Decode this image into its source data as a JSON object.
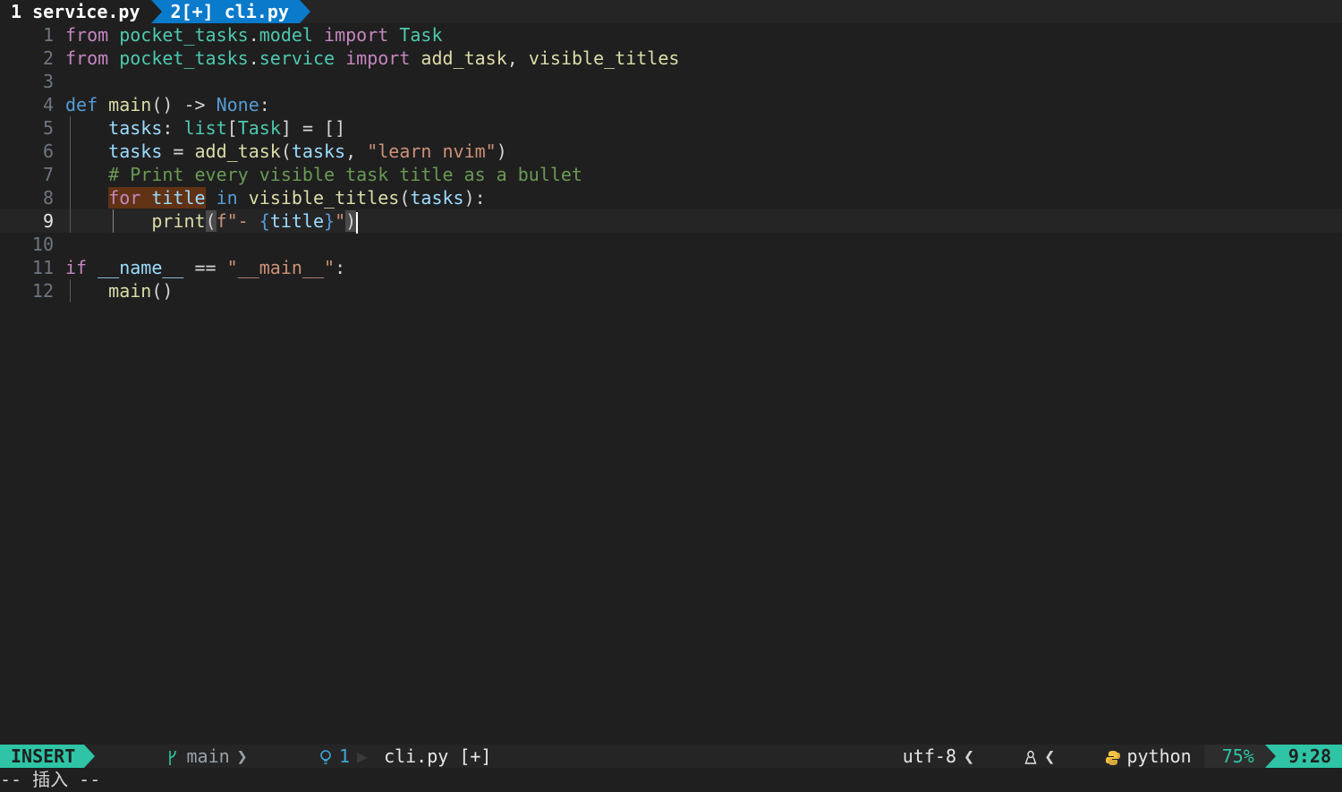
{
  "tabs": [
    {
      "label": "1 service.py",
      "active": false
    },
    {
      "label": "2[+] cli.py",
      "active": true
    }
  ],
  "editor": {
    "line_numbers": [
      "1",
      "2",
      "3",
      "4",
      "5",
      "6",
      "7",
      "8",
      "9",
      "10",
      "11",
      "12"
    ],
    "current_line": "9",
    "lines": [
      [
        {
          "t": "from",
          "c": "kw"
        },
        {
          "t": " ",
          "c": "op"
        },
        {
          "t": "pocket_tasks",
          "c": "cls"
        },
        {
          "t": ".",
          "c": "op"
        },
        {
          "t": "model",
          "c": "cls"
        },
        {
          "t": " ",
          "c": "op"
        },
        {
          "t": "import",
          "c": "kw"
        },
        {
          "t": " ",
          "c": "op"
        },
        {
          "t": "Task",
          "c": "cls"
        }
      ],
      [
        {
          "t": "from",
          "c": "kw"
        },
        {
          "t": " ",
          "c": "op"
        },
        {
          "t": "pocket_tasks",
          "c": "cls"
        },
        {
          "t": ".",
          "c": "op"
        },
        {
          "t": "service",
          "c": "cls"
        },
        {
          "t": " ",
          "c": "op"
        },
        {
          "t": "import",
          "c": "kw"
        },
        {
          "t": " ",
          "c": "op"
        },
        {
          "t": "add_task",
          "c": "fn"
        },
        {
          "t": ", ",
          "c": "op"
        },
        {
          "t": "visible_titles",
          "c": "fn"
        }
      ],
      [],
      [
        {
          "t": "def",
          "c": "kwb"
        },
        {
          "t": " ",
          "c": "op"
        },
        {
          "t": "main",
          "c": "fn"
        },
        {
          "t": "() -> ",
          "c": "op"
        },
        {
          "t": "None",
          "c": "kwb"
        },
        {
          "t": ":",
          "c": "op"
        }
      ],
      [
        {
          "t": "    ",
          "c": "op"
        },
        {
          "t": "tasks",
          "c": "var"
        },
        {
          "t": ": ",
          "c": "op"
        },
        {
          "t": "list",
          "c": "cls"
        },
        {
          "t": "[",
          "c": "op"
        },
        {
          "t": "Task",
          "c": "cls"
        },
        {
          "t": "] = []",
          "c": "op"
        }
      ],
      [
        {
          "t": "    ",
          "c": "op"
        },
        {
          "t": "tasks",
          "c": "var"
        },
        {
          "t": " = ",
          "c": "op"
        },
        {
          "t": "add_task",
          "c": "fn"
        },
        {
          "t": "(",
          "c": "op"
        },
        {
          "t": "tasks",
          "c": "var"
        },
        {
          "t": ", ",
          "c": "op"
        },
        {
          "t": "\"learn nvim\"",
          "c": "str"
        },
        {
          "t": ")",
          "c": "op"
        }
      ],
      [
        {
          "t": "    ",
          "c": "op"
        },
        {
          "t": "# Print every visible task title as a bullet",
          "c": "cmt"
        }
      ],
      [
        {
          "t": "    ",
          "c": "op"
        },
        {
          "t": "for",
          "c": "kw mark"
        },
        {
          "t": " ",
          "c": "op mark"
        },
        {
          "t": "title",
          "c": "var mark"
        },
        {
          "t": " ",
          "c": "op"
        },
        {
          "t": "in",
          "c": "kwb"
        },
        {
          "t": " ",
          "c": "op"
        },
        {
          "t": "visible_titles",
          "c": "fn"
        },
        {
          "t": "(",
          "c": "op"
        },
        {
          "t": "tasks",
          "c": "var"
        },
        {
          "t": "):",
          "c": "op"
        }
      ],
      [
        {
          "t": "        ",
          "c": "op"
        },
        {
          "t": "print",
          "c": "fn"
        },
        {
          "t": "(",
          "c": "op bracket"
        },
        {
          "t": "f\"- ",
          "c": "str"
        },
        {
          "t": "{",
          "c": "kwb"
        },
        {
          "t": "title",
          "c": "var"
        },
        {
          "t": "}",
          "c": "kwb"
        },
        {
          "t": "\"",
          "c": "str"
        },
        {
          "t": ")",
          "c": "op bracket"
        }
      ],
      [],
      [
        {
          "t": "if",
          "c": "kw"
        },
        {
          "t": " ",
          "c": "op"
        },
        {
          "t": "__name__",
          "c": "var"
        },
        {
          "t": " == ",
          "c": "op"
        },
        {
          "t": "\"__main__\"",
          "c": "str"
        },
        {
          "t": ":",
          "c": "op"
        }
      ],
      [
        {
          "t": "    ",
          "c": "op"
        },
        {
          "t": "main",
          "c": "fn"
        },
        {
          "t": "()",
          "c": "op"
        }
      ]
    ]
  },
  "statusline": {
    "mode": "INSERT",
    "git_icon": "git-branch-icon",
    "branch": "main",
    "diagnostic_icon": "lightbulb-icon",
    "diagnostic_count": "1",
    "filename": "cli.py [+]",
    "encoding": "utf-8",
    "os_icon": "linux-tux-icon",
    "filetype_icon": "python-icon",
    "filetype": "python",
    "progress": "75%",
    "position": "9:28"
  },
  "cmdline": {
    "text": "-- 插入 --"
  },
  "colors": {
    "accent": "#2ec4a5",
    "tab_active": "#0a7aca",
    "background": "#1f1f1f"
  }
}
